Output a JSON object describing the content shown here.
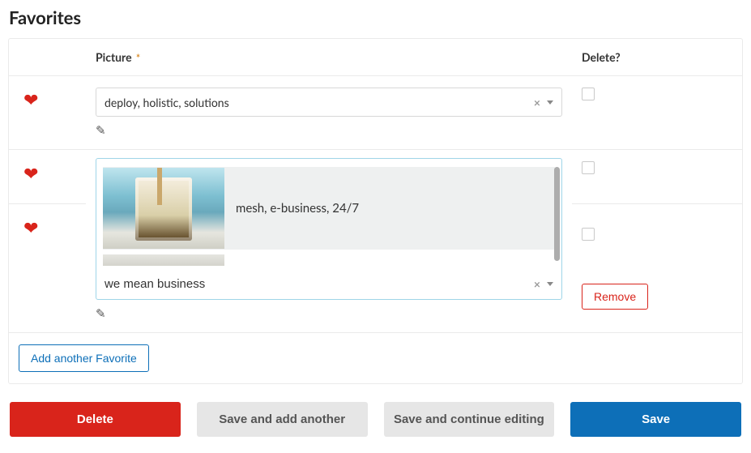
{
  "title": "Favorites",
  "columns": {
    "picture": "Picture",
    "delete": "Delete?"
  },
  "rows": [
    {
      "value": "deploy, holistic, solutions"
    },
    {
      "open_dropdown": true,
      "option_label": "mesh, e-business, 24/7",
      "search_value": "we mean business"
    },
    {
      "value": ""
    }
  ],
  "remove_label": "Remove",
  "add_label": "Add another Favorite",
  "buttons": {
    "delete": "Delete",
    "save_add": "Save and add another",
    "save_cont": "Save and continue editing",
    "save": "Save"
  }
}
